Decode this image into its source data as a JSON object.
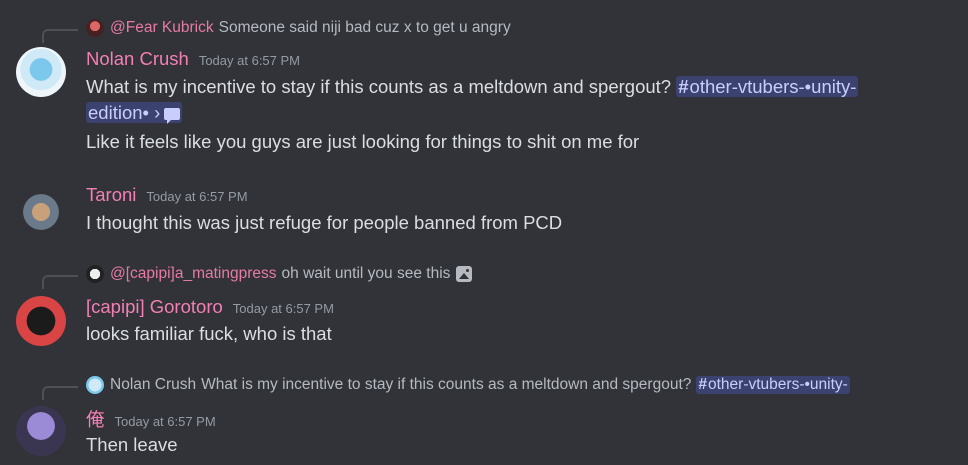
{
  "messages": [
    {
      "reply": {
        "author": "@Fear Kubrick",
        "text": "Someone said niji bad cuz x to get u angry"
      },
      "author": "Nolan Crush",
      "time": "Today at 6:57 PM",
      "line1_text": "What is my incentive to stay if this counts as a meltdown and spergout?",
      "channel": "other-vtubers-•unity-",
      "channel_cont": "edition•",
      "channel_arrow": "›",
      "line3": "Like it feels like you guys are just looking for things to shit on me for"
    },
    {
      "author": "Taroni",
      "time": "Today at 6:57 PM",
      "line1": "I thought this was just refuge for people banned from PCD"
    },
    {
      "reply": {
        "author": "@[capipi]a_matingpress",
        "text": "oh wait until you see this"
      },
      "author": "[capipi] Gorotoro",
      "time": "Today at 6:57 PM",
      "line1": "looks familiar fuck, who is that"
    },
    {
      "reply": {
        "author": "Nolan Crush",
        "text": "What is my incentive to stay if this counts as a meltdown and spergout?",
        "channel": "other-vtubers-•unity-"
      },
      "author": "俺",
      "time": "Today at 6:57 PM",
      "line1": "Then leave"
    }
  ],
  "channel_hash": "#",
  "colors": {
    "background": "#313338",
    "username": "#f47fb4",
    "mention": "#c9cdfb",
    "mention_bg": "#3c4270"
  },
  "icons": [
    "image-icon",
    "thread-icon"
  ]
}
